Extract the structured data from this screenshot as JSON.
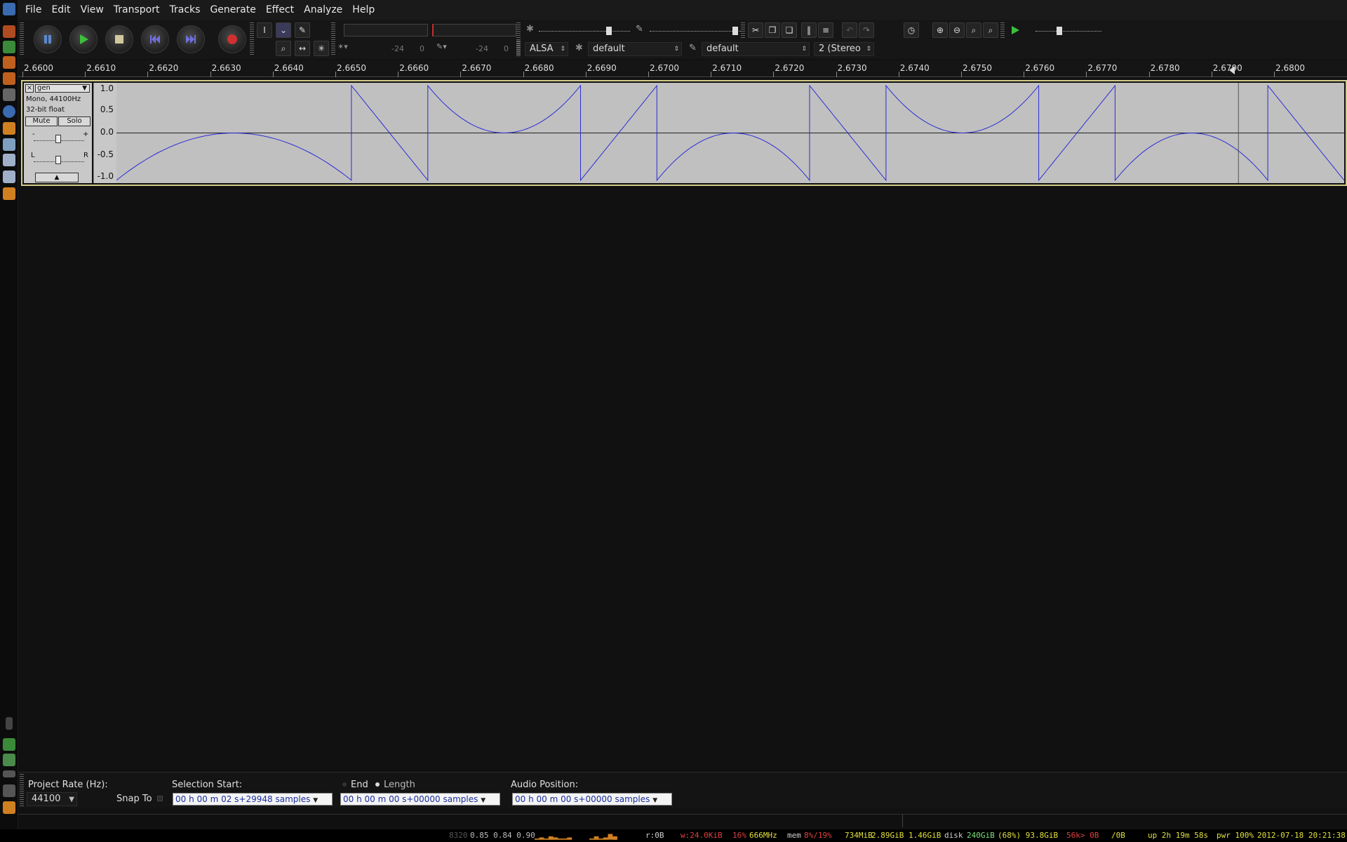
{
  "menu": [
    "File",
    "Edit",
    "View",
    "Transport",
    "Tracks",
    "Generate",
    "Effect",
    "Analyze",
    "Help"
  ],
  "meter": {
    "rec_label": "-24",
    "rec_zero": "0",
    "play_label": "-24",
    "play_zero": "0"
  },
  "device": {
    "host": "ALSA",
    "output": "default",
    "input": "default",
    "channels": "2 (Stereo"
  },
  "ruler": {
    "labels": [
      "2.6600",
      "2.6610",
      "2.6620",
      "2.6630",
      "2.6640",
      "2.6650",
      "2.6660",
      "2.6670",
      "2.6680",
      "2.6690",
      "2.6700",
      "2.6710",
      "2.6720",
      "2.6730",
      "2.6740",
      "2.6750",
      "2.6760",
      "2.6770",
      "2.6780",
      "2.6790",
      "2.6800"
    ]
  },
  "track": {
    "name": "gen",
    "info1": "Mono, 44100Hz",
    "info2": "32-bit float",
    "mute": "Mute",
    "solo": "Solo",
    "gain_minus": "-",
    "gain_plus": "+",
    "pan_left": "L",
    "pan_right": "R",
    "scale": [
      "1.0",
      "0.5",
      "0.0",
      "-0.5",
      "-1.0"
    ]
  },
  "selection": {
    "rate_label": "Project Rate (Hz):",
    "rate_value": "44100",
    "snap_label": "Snap To",
    "start_label": "Selection Start:",
    "start_value": "00 h 00 m 02 s+29948 samples",
    "end_label": "End",
    "length_label": "Length",
    "length_value": "00 h 00 m 00 s+00000 samples",
    "pos_label": "Audio Position:",
    "pos_value": "00 h 00 m 00 s+00000 samples"
  },
  "sysbar": {
    "load_idle": "8320",
    "load": "0.85 0.84 0.90",
    "r": "r:0B",
    "w": "w:24.0KiB",
    "cpu": "16%",
    "freq": "666MHz",
    "mem_label": "mem",
    "mem_pct": "8%/19%",
    "mem": "734MiB",
    "mem2": "2.89GiB 1.46GiB",
    "disk_label": "disk",
    "disk": "240GiB",
    "disk_pct": "(68%) 93.8GiB",
    "net": "56k> 0B",
    "net2": "/0B",
    "up": "up 2h 19m 58s",
    "pwr": "pwr 100%",
    "datetime": "2012-07-18 20:21:38"
  },
  "colors": {
    "waveform": "#2b2bd6",
    "track_border": "#d4cc8a",
    "wave_bg": "#c0c0c0"
  },
  "chart_data": {
    "type": "line",
    "series_description_from_screen": "piecewise waveform",
    "x_range": [
      2.6597,
      2.6806
    ],
    "ylim": [
      -1.0,
      1.0
    ],
    "segments": [
      {
        "shape": "arch",
        "x0": 2.6597,
        "x1": 2.6637,
        "peak": 0.0,
        "base": -1.0
      },
      {
        "shape": "rampdown",
        "x0": 2.6637,
        "x1": 2.665,
        "from": 1.0,
        "to": -1.0
      },
      {
        "shape": "bowl",
        "x0": 2.665,
        "x1": 2.6676,
        "peak": 1.0,
        "base": 0.0
      },
      {
        "shape": "rampup",
        "x0": 2.6676,
        "x1": 2.6689,
        "from": -1.0,
        "to": 1.0
      },
      {
        "shape": "arch",
        "x0": 2.6689,
        "x1": 2.6715,
        "peak": 0.0,
        "base": -1.0
      },
      {
        "shape": "rampdown",
        "x0": 2.6715,
        "x1": 2.6728,
        "from": 1.0,
        "to": -1.0
      },
      {
        "shape": "bowl",
        "x0": 2.6728,
        "x1": 2.6754,
        "peak": 1.0,
        "base": 0.0
      },
      {
        "shape": "rampup",
        "x0": 2.6754,
        "x1": 2.6767,
        "from": -1.0,
        "to": 1.0
      },
      {
        "shape": "arch",
        "x0": 2.6767,
        "x1": 2.6793,
        "peak": 0.0,
        "base": -1.0
      },
      {
        "shape": "rampdown",
        "x0": 2.6793,
        "x1": 2.6806,
        "from": 1.0,
        "to": -1.0
      }
    ],
    "cursor_x": 2.6788
  }
}
